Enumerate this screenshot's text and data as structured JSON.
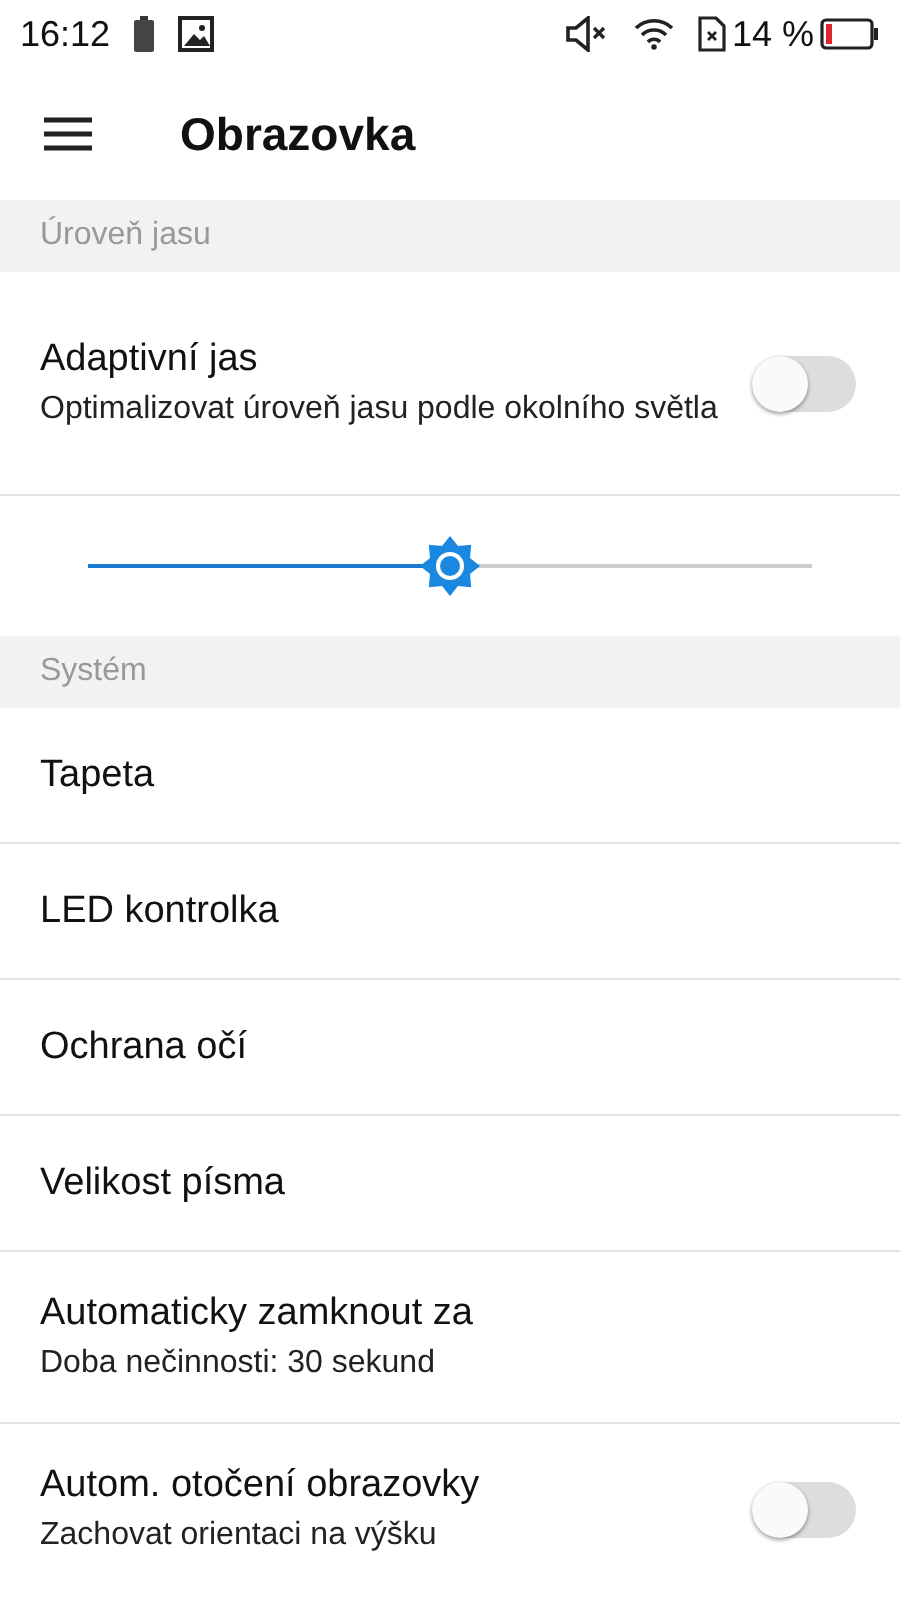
{
  "status_bar": {
    "time": "16:12",
    "battery_percent": "14 %"
  },
  "app_bar": {
    "title": "Obrazovka"
  },
  "items": [
    {
      "kind": "header",
      "title": "Úroveň jasu"
    },
    {
      "kind": "switch",
      "title": "Adaptivní jas",
      "summary": "Optimalizovat úroveň jasu podle okolního světla",
      "on": false
    },
    {
      "kind": "slider",
      "level": 0.5
    },
    {
      "kind": "header",
      "title": "Systém"
    },
    {
      "kind": "plain",
      "title": "Tapeta"
    },
    {
      "kind": "plain",
      "title": "LED kontrolka"
    },
    {
      "kind": "plain",
      "title": "Ochrana očí"
    },
    {
      "kind": "plain",
      "title": "Velikost písma"
    },
    {
      "kind": "summary",
      "title": "Automaticky zamknout za",
      "summary": "Doba nečinnosti: 30 sekund"
    },
    {
      "kind": "switch",
      "title": "Autom. otočení obrazovky",
      "summary": "Zachovat orientaci na výšku",
      "on": false
    }
  ]
}
